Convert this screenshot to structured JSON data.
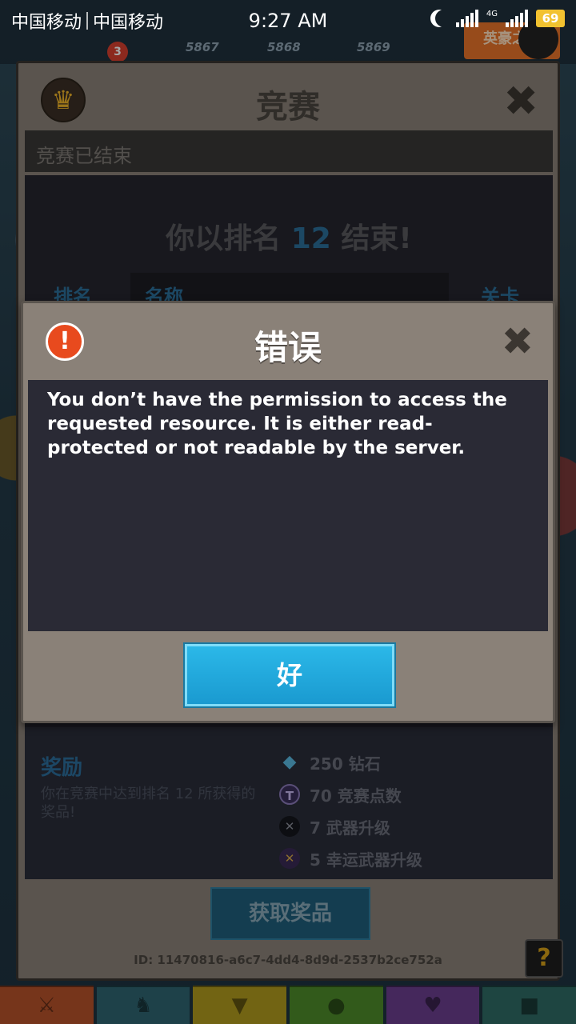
{
  "status_bar": {
    "carrier1": "中国移动",
    "carrier2": "中国移动",
    "time": "9:27 AM",
    "network": "4G",
    "battery": "69"
  },
  "hud": {
    "badge_count": "3",
    "scores": [
      "5867",
      "5868",
      "5869"
    ],
    "event_label": "英豪之战"
  },
  "competition": {
    "title": "竞赛",
    "subtitle": "竞赛已结束",
    "rank_prefix": "你以排名",
    "rank_number": "12",
    "rank_suffix": "结束!",
    "columns": [
      "排名",
      "名称",
      "关卡"
    ],
    "reward_title": "奖励",
    "reward_desc": "你在竞赛中达到排名 12 所获得的奖品!",
    "rewards": [
      {
        "label": "250 钻石",
        "icon": "diamond-icon"
      },
      {
        "label": "70 竞赛点数",
        "icon": "token-icon"
      },
      {
        "label": "7 武器升级",
        "icon": "weapon-icon"
      },
      {
        "label": "5 幸运武器升级",
        "icon": "lucky-weapon-icon"
      }
    ],
    "claim_button": "获取奖品",
    "id_text": "ID: 11470816-a6c7-4dd4-8d9d-2537b2ce752a",
    "help_label": "?"
  },
  "error_dialog": {
    "title": "错误",
    "message": "You don’t have the permission to access the requested resource. It is either read-protected or not readable by the server.",
    "ok_button": "好",
    "icon_glyph": "!",
    "close_glyph": "✖"
  },
  "colors": {
    "accent_blue": "#2bb8e8",
    "panel": "#8a8178",
    "body_dark": "#2a2a35",
    "error_red": "#e84a1e"
  }
}
